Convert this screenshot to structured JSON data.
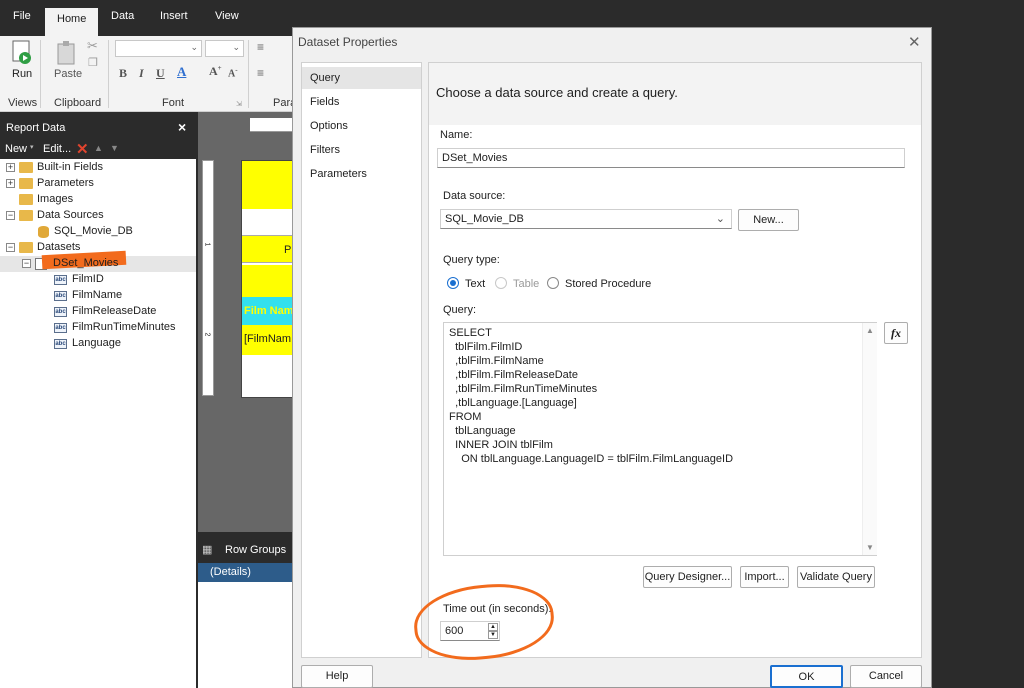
{
  "ribbon": {
    "tabs": [
      "File",
      "Home",
      "Data",
      "Insert",
      "View"
    ],
    "run_label": "Run",
    "paste_label": "Paste",
    "groups": [
      "Views",
      "Clipboard",
      "Font",
      "Para"
    ]
  },
  "report_data": {
    "title": "Report Data",
    "new_label": "New",
    "edit_label": "Edit...",
    "tree": {
      "builtin_fields": "Built-in Fields",
      "parameters": "Parameters",
      "images": "Images",
      "data_sources": "Data Sources",
      "data_source_item": "SQL_Movie_DB",
      "datasets": "Datasets",
      "dataset_item": "DSet_Movies",
      "fields": [
        "FilmID",
        "FilmName",
        "FilmReleaseDate",
        "FilmRunTimeMinutes",
        "Language"
      ]
    }
  },
  "design": {
    "row_groups_label": "Row Groups",
    "details_label": "(Details)",
    "cell_film_name": "Film Nam",
    "cell_film_name_expr": "[FilmNam",
    "cell_p": "P"
  },
  "dialog": {
    "title": "Dataset Properties",
    "nav": [
      "Query",
      "Fields",
      "Options",
      "Filters",
      "Parameters"
    ],
    "heading": "Choose a data source and create a query.",
    "name_label": "Name:",
    "name_value": "DSet_Movies",
    "datasource_label": "Data source:",
    "datasource_value": "SQL_Movie_DB",
    "new_button": "New...",
    "query_type_label": "Query type:",
    "query_types": [
      "Text",
      "Table",
      "Stored Procedure"
    ],
    "query_label": "Query:",
    "query_lines": [
      "SELECT",
      "  tblFilm.FilmID",
      "  ,tblFilm.FilmName",
      "  ,tblFilm.FilmReleaseDate",
      "  ,tblFilm.FilmRunTimeMinutes",
      "  ,tblLanguage.[Language]",
      "FROM",
      "  tblLanguage",
      "  INNER JOIN tblFilm",
      "    ON tblLanguage.LanguageID = tblFilm.FilmLanguageID"
    ],
    "fx_label": "fx",
    "query_designer_button": "Query Designer...",
    "import_button": "Import...",
    "validate_button": "Validate Query",
    "timeout_label": "Time out (in seconds):",
    "timeout_value": "600",
    "help_button": "Help",
    "ok_button": "OK",
    "cancel_button": "Cancel"
  },
  "colors": {
    "accent": "#1a6fd0",
    "annotation": "#f26b1d",
    "dark_chrome": "#2b2b2b",
    "report_yellow": "#ffff00",
    "report_cyan": "#33e0ee"
  }
}
